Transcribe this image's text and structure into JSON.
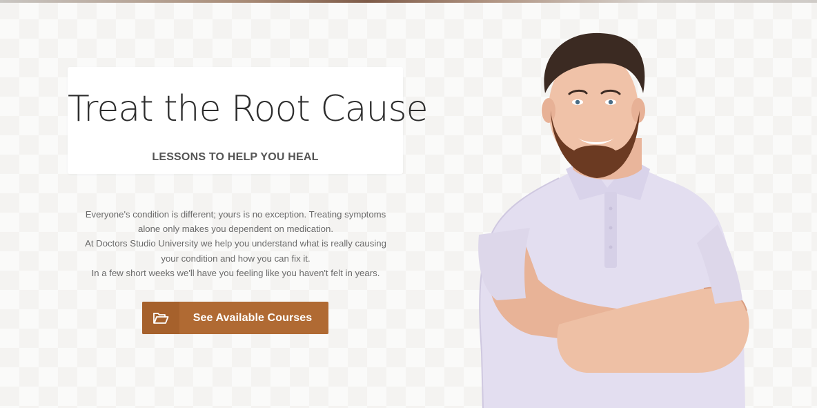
{
  "hero": {
    "title": "Treat the Root Cause",
    "subtitle": "LESSONS TO HELP YOU HEAL",
    "description_lines": [
      "Everyone's condition is different; yours is no exception. Treating symptoms",
      "alone only makes you dependent on medication.",
      "At Doctors Studio University we help you understand what is really causing",
      "your condition and how you can fix it.",
      "In a few short weeks we'll have you feeling like you haven't felt in years."
    ],
    "cta": {
      "label": "See Available Courses",
      "icon": "folder-open-icon"
    }
  },
  "colors": {
    "accent": "#b06a33",
    "accent_dark": "#a6612c",
    "title_text": "#2d2d2d",
    "body_text": "#6a6a6a",
    "background": "#f4f3f1"
  }
}
